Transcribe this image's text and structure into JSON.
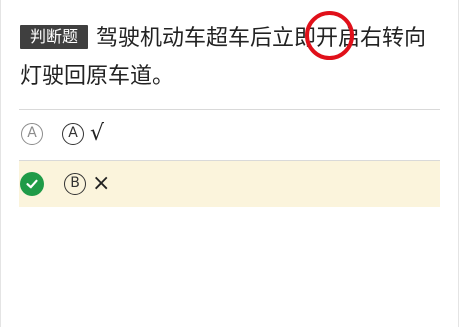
{
  "question": {
    "type_badge": "判断题",
    "text": "驾驶机动车超车后立即开启右转向灯驶回原车道。"
  },
  "options": [
    {
      "marker": "A",
      "letter": "A",
      "text": "√",
      "selected": false
    },
    {
      "marker_icon": "check-circle-icon",
      "letter": "B",
      "text": "×",
      "selected": true
    }
  ],
  "colors": {
    "badge_background": "#3f3f3f",
    "annotation_ring": "#e0101a",
    "correct_check": "#1f9b48",
    "selected_row_background": "#fbf4dc"
  }
}
